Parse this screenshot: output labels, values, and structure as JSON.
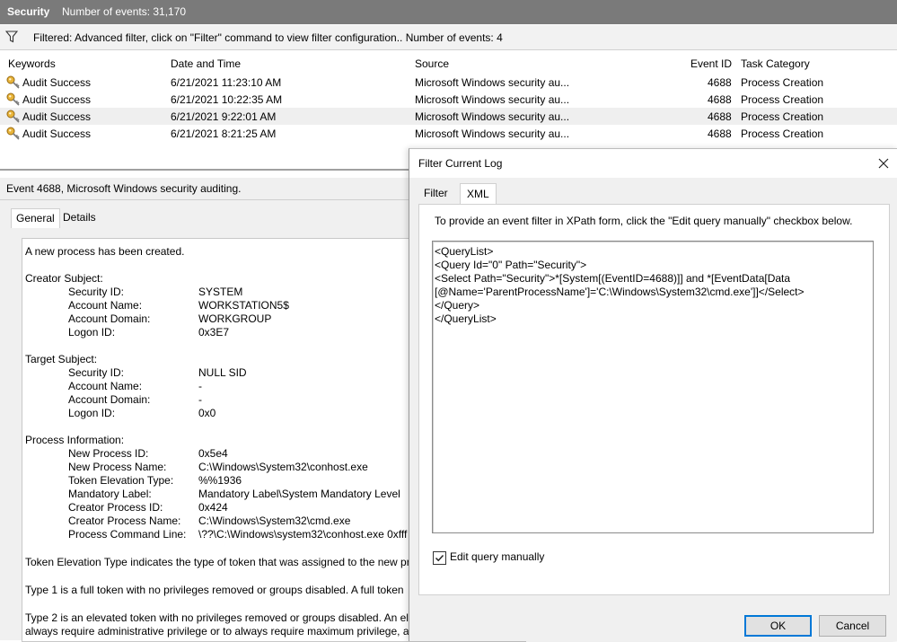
{
  "header": {
    "log_name": "Security",
    "event_count_text": "Number of events: 31,170"
  },
  "filter_bar": {
    "text": "Filtered: Advanced filter, click on \"Filter\" command to view filter configuration.. Number of events: 4"
  },
  "event_list": {
    "columns": [
      "Keywords",
      "Date and Time",
      "Source",
      "Event ID",
      "Task Category"
    ],
    "rows": [
      {
        "keyword": "Audit Success",
        "datetime": "6/21/2021 11:23:10 AM",
        "source": "Microsoft Windows security au...",
        "event_id": "4688",
        "category": "Process Creation"
      },
      {
        "keyword": "Audit Success",
        "datetime": "6/21/2021 10:22:35 AM",
        "source": "Microsoft Windows security au...",
        "event_id": "4688",
        "category": "Process Creation"
      },
      {
        "keyword": "Audit Success",
        "datetime": "6/21/2021 9:22:01 AM",
        "source": "Microsoft Windows security au...",
        "event_id": "4688",
        "category": "Process Creation"
      },
      {
        "keyword": "Audit Success",
        "datetime": "6/21/2021 8:21:25 AM",
        "source": "Microsoft Windows security au...",
        "event_id": "4688",
        "category": "Process Creation"
      }
    ],
    "selected_index": 2
  },
  "detail": {
    "title": "Event 4688, Microsoft Windows security auditing.",
    "tabs": [
      "General",
      "Details"
    ],
    "active_tab": "General",
    "lines": {
      "intro": "A new process has been created.",
      "creator_hdr": "Creator Subject:",
      "c_sid_l": "Security ID:",
      "c_sid_v": "SYSTEM",
      "c_an_l": "Account Name:",
      "c_an_v": "WORKSTATION5$",
      "c_ad_l": "Account Domain:",
      "c_ad_v": "WORKGROUP",
      "c_li_l": "Logon ID:",
      "c_li_v": "0x3E7",
      "target_hdr": "Target Subject:",
      "t_sid_l": "Security ID:",
      "t_sid_v": "NULL SID",
      "t_an_l": "Account Name:",
      "t_an_v": "-",
      "t_ad_l": "Account Domain:",
      "t_ad_v": "-",
      "t_li_l": "Logon ID:",
      "t_li_v": "0x0",
      "proc_hdr": "Process Information:",
      "p_id_l": "New Process ID:",
      "p_id_v": "0x5e4",
      "p_name_l": "New Process Name:",
      "p_name_v": "C:\\Windows\\System32\\conhost.exe",
      "p_tet_l": "Token Elevation Type:",
      "p_tet_v": "%%1936",
      "p_ml_l": "Mandatory Label:",
      "p_ml_v": "Mandatory Label\\System Mandatory Level",
      "p_cpid_l": "Creator Process ID:",
      "p_cpid_v": "0x424",
      "p_cpn_l": "Creator Process Name:",
      "p_cpn_v": "C:\\Windows\\System32\\cmd.exe",
      "p_cmd_l": "Process Command Line:",
      "p_cmd_v": "\\??\\C:\\Windows\\system32\\conhost.exe 0xfff",
      "para1": "Token Elevation Type indicates the type of token that was assigned to the new pro",
      "para2": "Type 1 is a full token with no privileges removed or groups disabled.  A full token",
      "para3a": "Type 2 is an elevated token with no privileges removed or groups disabled.  An ele",
      "para3b": "always require administrative privilege or to always require maximum privilege, a"
    }
  },
  "dialog": {
    "title": "Filter Current Log",
    "tabs": [
      "Filter",
      "XML"
    ],
    "active_tab": "XML",
    "description": "To provide an event filter in XPath form, click the \"Edit query manually\" checkbox below.",
    "xml_lines": [
      "<QueryList>",
      "  <Query Id=\"0\" Path=\"Security\">",
      "    <Select Path=\"Security\">*[System[(EventID=4688)]] and *[EventData[Data",
      "[@Name='ParentProcessName']='C:\\Windows\\System32\\cmd.exe']]</Select>",
      "  </Query>",
      "</QueryList>"
    ],
    "checkbox_label": "Edit query manually",
    "checkbox_checked": true,
    "ok_label": "OK",
    "cancel_label": "Cancel"
  }
}
